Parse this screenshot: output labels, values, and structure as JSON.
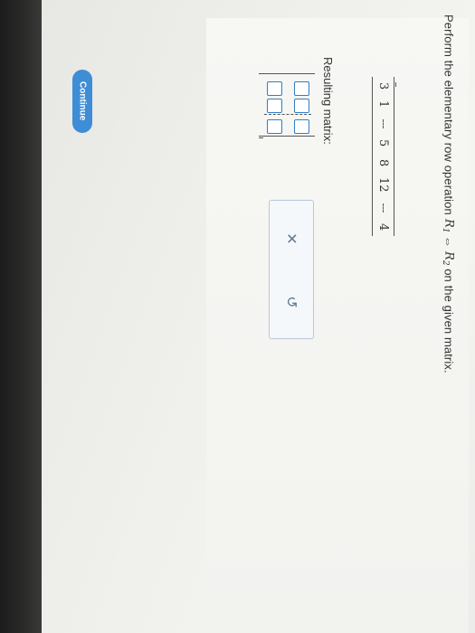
{
  "question": {
    "prefix": "Perform the elementary row operation ",
    "r1": "R",
    "r1_sub": "1",
    "arrow": " ⇔ ",
    "r2": "R",
    "r2_sub": "2",
    "suffix": " on the given matrix."
  },
  "given_matrix": {
    "rows": [
      [
        "3",
        "1",
        "5"
      ],
      [
        "8",
        "12",
        "4"
      ]
    ]
  },
  "result_label": "Resulting matrix:",
  "tools": {
    "clear_icon": "✕",
    "undo_icon": "↺"
  },
  "continue_label": "Continue"
}
